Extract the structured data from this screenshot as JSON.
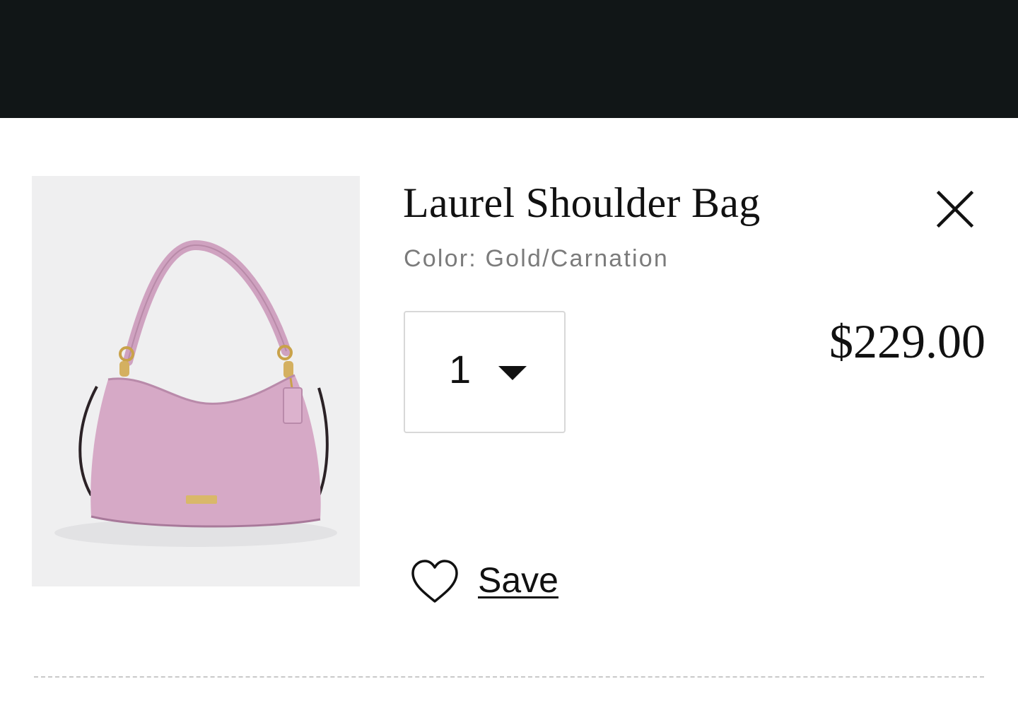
{
  "product": {
    "title": "Laurel Shoulder Bag",
    "color_line": "Color: Gold/Carnation",
    "price": "$229.00",
    "bag_color": "#d6a9c6"
  },
  "quantity": {
    "selected": "1"
  },
  "actions": {
    "save_label": "Save",
    "remove_icon": "close-icon",
    "save_icon": "heart-outline-icon"
  },
  "colors": {
    "top_bar": "#111617",
    "image_background": "#efeff0",
    "text_primary": "#111111",
    "text_secondary": "#7b7b7b"
  }
}
